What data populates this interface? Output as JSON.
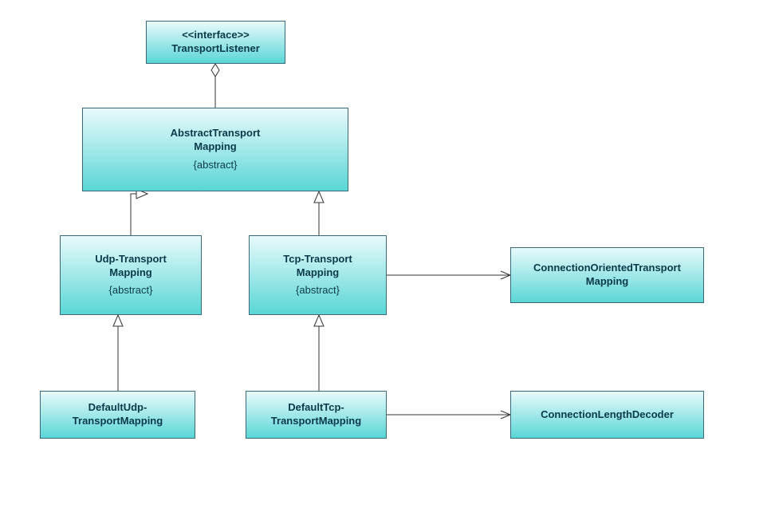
{
  "boxes": {
    "transportListener": {
      "stereotype": "<<interface>>",
      "name": "TransportListener"
    },
    "abstractTransportMapping": {
      "name1": "AbstractTransport",
      "name2": "Mapping",
      "constraint": "{abstract}"
    },
    "udpTransportMapping": {
      "name1": "Udp-Transport",
      "name2": "Mapping",
      "constraint": "{abstract}"
    },
    "tcpTransportMapping": {
      "name1": "Tcp-Transport",
      "name2": "Mapping",
      "constraint": "{abstract}"
    },
    "connectionOrientedTransportMapping": {
      "name1": "ConnectionOrientedTransport",
      "name2": "Mapping"
    },
    "defaultUdpTransportMapping": {
      "name1": "DefaultUdp-",
      "name2": "TransportMapping"
    },
    "defaultTcpTransportMapping": {
      "name1": "DefaultTcp-",
      "name2": "TransportMapping"
    },
    "connectionLengthDecoder": {
      "name": "ConnectionLengthDecoder"
    }
  }
}
